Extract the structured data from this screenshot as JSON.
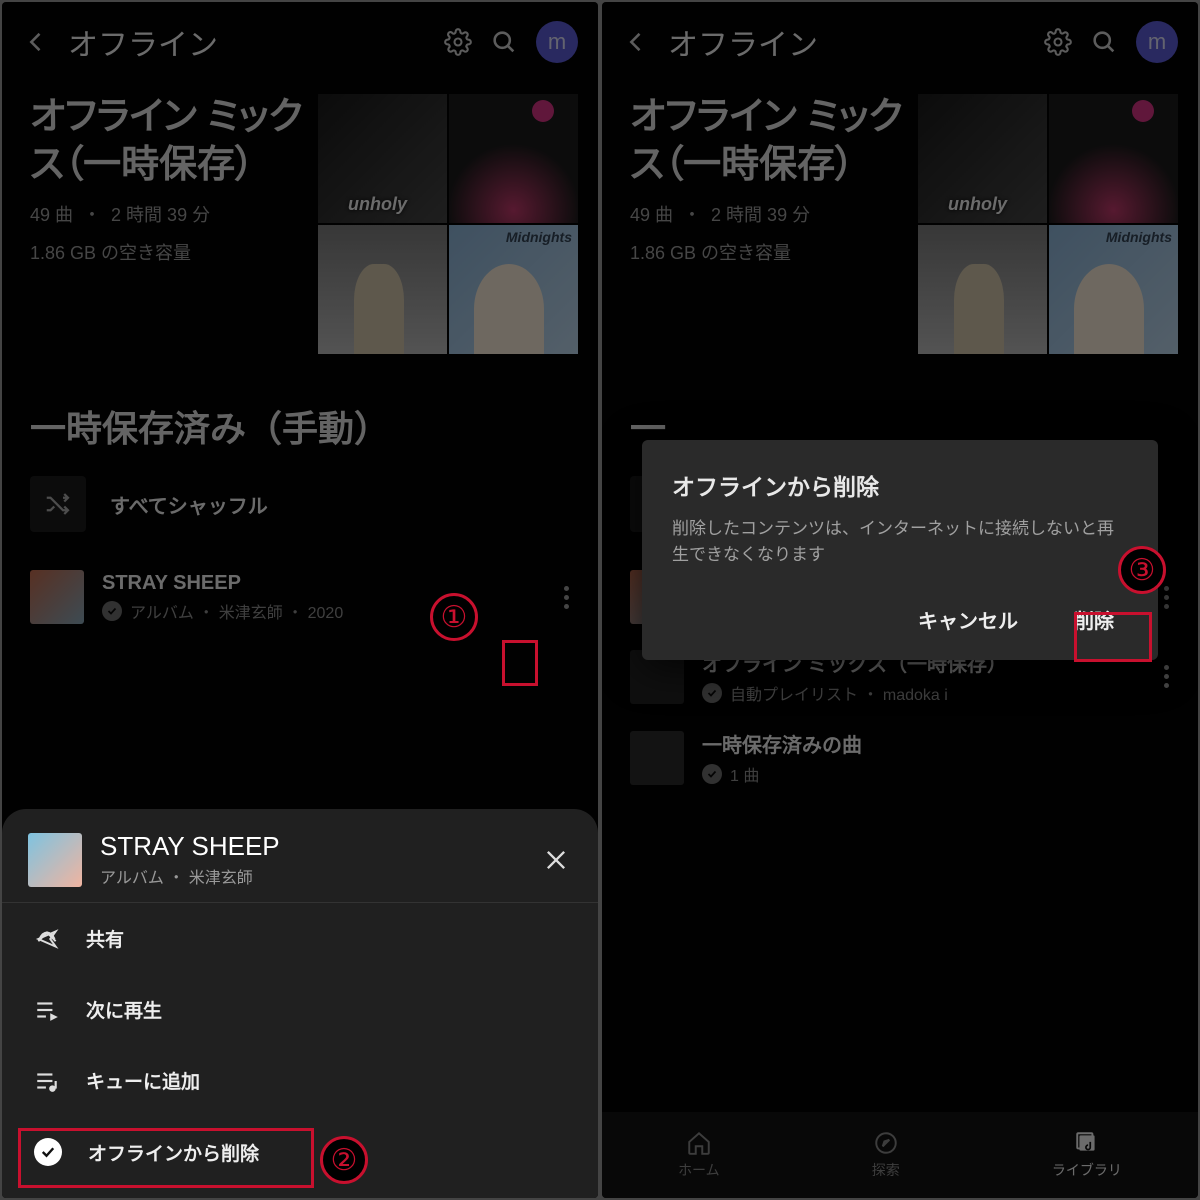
{
  "header": {
    "title": "オフライン",
    "avatar_letter": "m"
  },
  "mix": {
    "title": "オフライン ミックス（一時保存）",
    "songs_label": "49 曲",
    "duration_label": "2 時間 39 分",
    "storage_label": "1.86 GB の空き容量",
    "art1_label": "unholy",
    "art4_label": "Midnights"
  },
  "section": {
    "saved_manual": "一時保存済み（手動）",
    "shuffle_all": "すべてシャッフル"
  },
  "item1": {
    "title": "STRAY SHEEP",
    "meta": "アルバム ・ 米津玄師 ・ 2020"
  },
  "item2": {
    "title": "オフライン ミックス（一時保存）",
    "meta": "自動プレイリスト ・ madoka i"
  },
  "item3": {
    "title": "一時保存済みの曲",
    "meta": "1 曲"
  },
  "sheet": {
    "title": "STRAY SHEEP",
    "sub": "アルバム  ・  米津玄師",
    "share": "共有",
    "play_next": "次に再生",
    "add_queue": "キューに追加",
    "remove_offline": "オフラインから削除"
  },
  "dialog": {
    "title": "オフラインから削除",
    "message": "削除したコンテンツは、インターネットに接続しないと再生できなくなります",
    "cancel": "キャンセル",
    "delete": "削除"
  },
  "nav": {
    "home": "ホーム",
    "explore": "探索",
    "library": "ライブラリ"
  },
  "callouts": {
    "c1": "①",
    "c2": "②",
    "c3": "③"
  }
}
